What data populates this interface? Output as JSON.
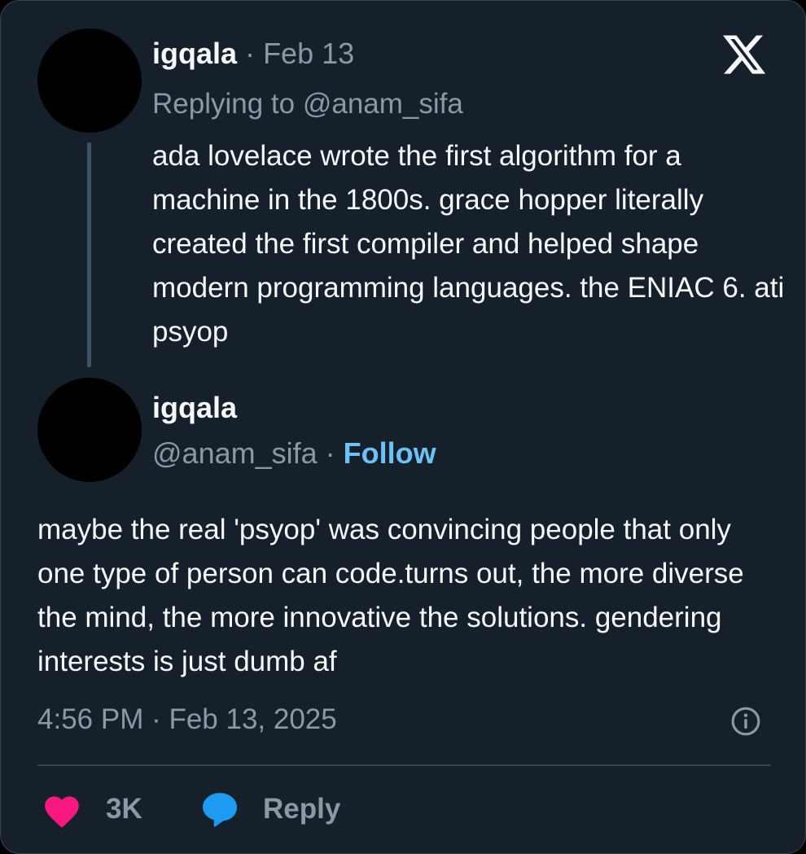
{
  "parent_tweet": {
    "name": "igqala",
    "separator": "·",
    "date": "Feb 13",
    "replying_prefix": "Replying to",
    "replying_handle": "@anam_sifa",
    "text": "ada lovelace wrote the first algorithm for a machine in the 1800s. grace hopper literally created the first compiler and helped shape modern programming languages. the ENIAC 6. ati psyop"
  },
  "main_tweet": {
    "name": "igqala",
    "handle": "@anam_sifa",
    "separator": "·",
    "follow_label": "Follow",
    "text": "maybe the real 'psyop' was convincing people that only one type of person can code.turns out, the more diverse the mind, the more innovative the solutions. gendering interests is just dumb af",
    "timestamp": "4:56 PM · Feb 13, 2025"
  },
  "actions": {
    "like_count": "3K",
    "reply_label": "Reply"
  },
  "colors": {
    "background": "#15202b",
    "text": "#f7f9f9",
    "muted": "#8b98a5",
    "follow": "#6cc2f5",
    "heart": "#f91880",
    "reply": "#1d9bf0",
    "thread_line": "#3d5466"
  },
  "icons": {
    "brand": "x-logo-icon",
    "info": "info-icon",
    "like": "heart-icon",
    "reply": "speech-bubble-icon"
  }
}
